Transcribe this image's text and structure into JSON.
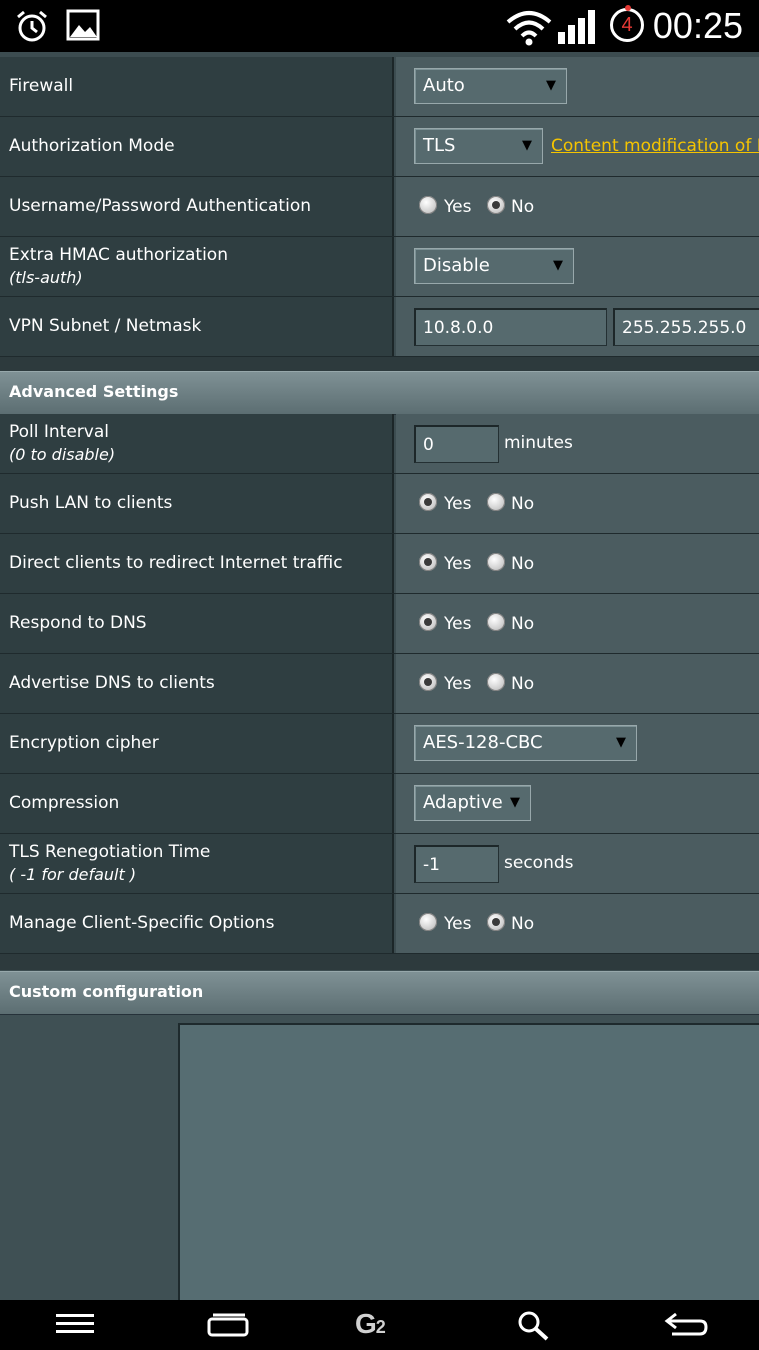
{
  "status_bar": {
    "time": "00:25",
    "notification_count": "4",
    "icons": [
      "alarm-icon",
      "gallery-icon",
      "wifi-icon",
      "signal-icon"
    ]
  },
  "rows_top": [
    {
      "label": "Firewall",
      "select": "Auto"
    },
    {
      "label": "Authorization Mode",
      "select": "TLS",
      "link": "Content modification of K"
    },
    {
      "label": "Username/Password Authentication",
      "radio": {
        "yes": "Yes",
        "no": "No",
        "selected": "no"
      }
    },
    {
      "label": "Extra HMAC authorization",
      "sublabel": "(tls-auth)",
      "select": "Disable"
    },
    {
      "label": "VPN Subnet / Netmask",
      "subnet": "10.8.0.0",
      "netmask": "255.255.255.0"
    }
  ],
  "advanced": {
    "header": "Advanced Settings",
    "poll": {
      "label": "Poll Interval",
      "sublabel": "(0 to disable)",
      "value": "0",
      "unit": "minutes"
    },
    "push_lan": {
      "label": "Push LAN to clients",
      "yes": "Yes",
      "no": "No",
      "selected": "yes"
    },
    "redirect": {
      "label": "Direct clients to redirect Internet traffic",
      "yes": "Yes",
      "no": "No",
      "selected": "yes"
    },
    "respond_dns": {
      "label": "Respond to DNS",
      "yes": "Yes",
      "no": "No",
      "selected": "yes"
    },
    "advertise_dns": {
      "label": "Advertise DNS to clients",
      "yes": "Yes",
      "no": "No",
      "selected": "yes"
    },
    "cipher": {
      "label": "Encryption cipher",
      "value": "AES-128-CBC"
    },
    "compression": {
      "label": "Compression",
      "value": "Adaptive"
    },
    "tls_reneg": {
      "label": "TLS Renegotiation Time",
      "sublabel": "( -1 for default )",
      "value": "-1",
      "unit": "seconds"
    },
    "client_specific": {
      "label": "Manage Client-Specific Options",
      "yes": "Yes",
      "no": "No",
      "selected": "no"
    }
  },
  "custom": {
    "header": "Custom configuration",
    "text": ""
  },
  "nav_bar": {
    "brand": "G",
    "brand_sub": "2",
    "icons": [
      "menu-icon",
      "recent-apps-icon",
      "search-icon",
      "back-icon"
    ]
  }
}
